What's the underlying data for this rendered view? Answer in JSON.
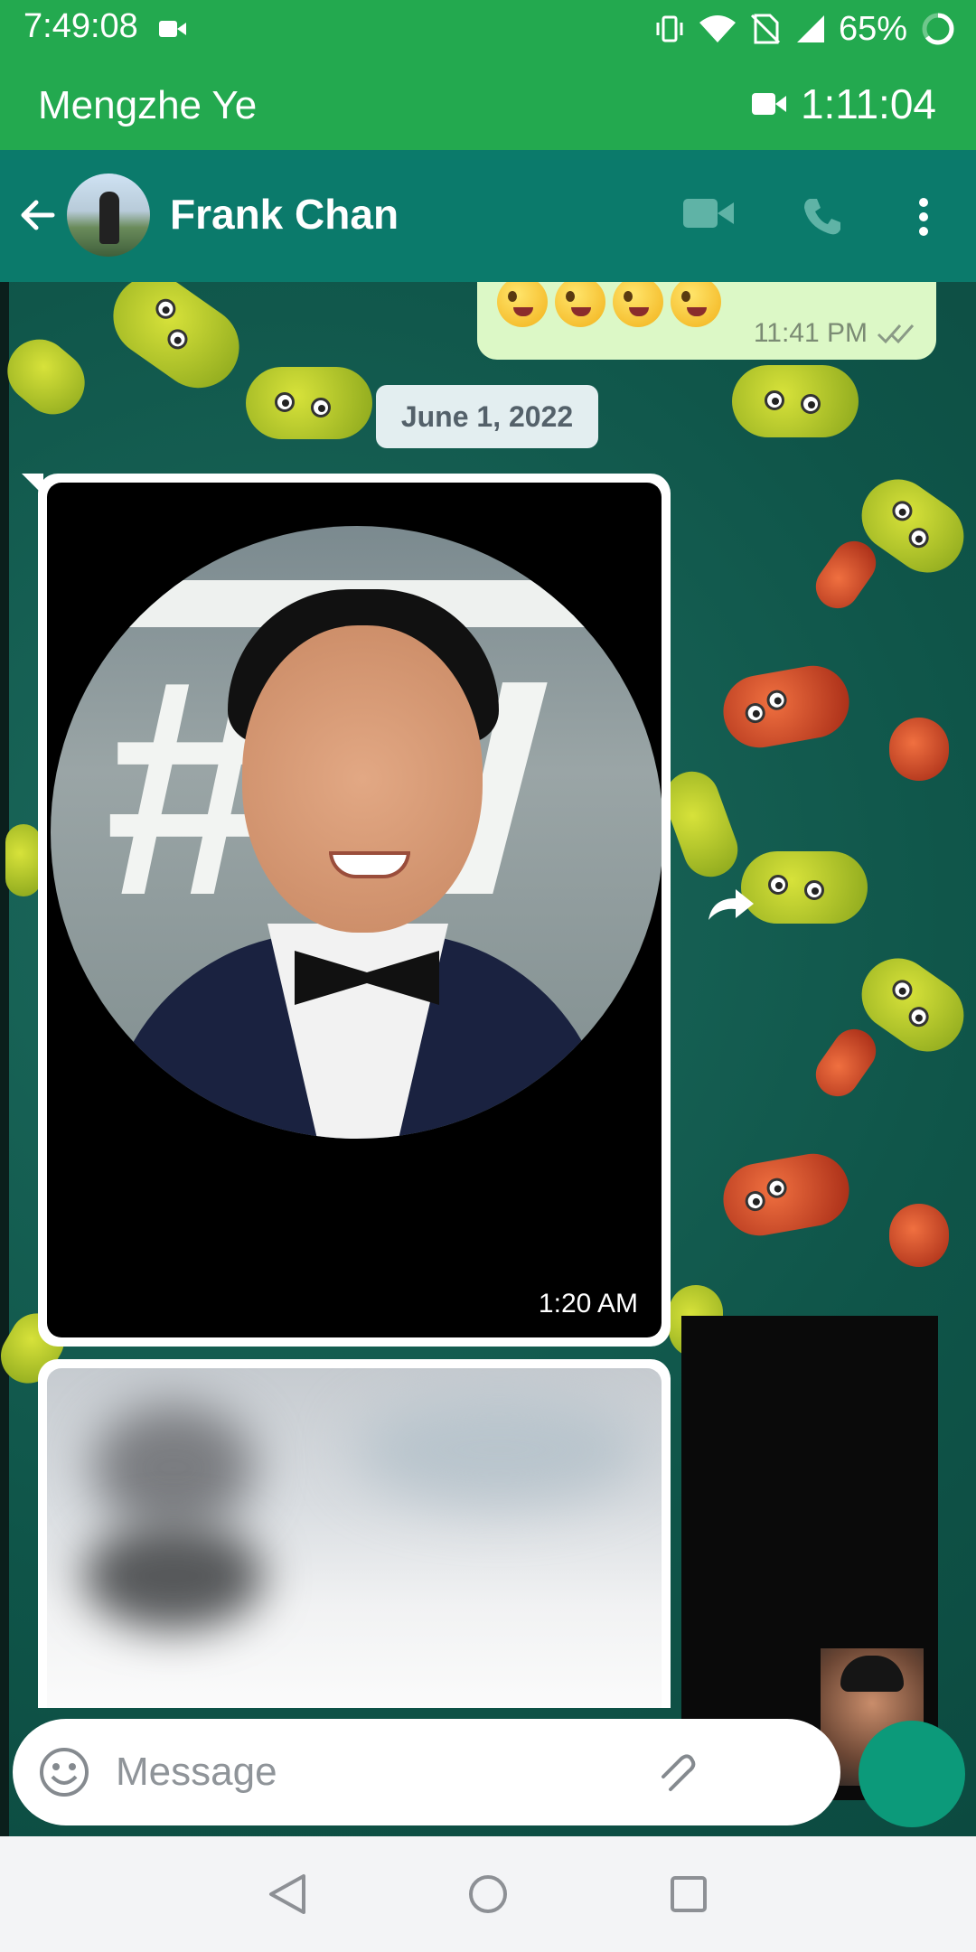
{
  "status_bar": {
    "time": "7:49:08",
    "battery": "65%",
    "icons": [
      "video-record-icon",
      "vibrate-icon",
      "wifi-icon",
      "no-sim-icon",
      "signal-icon",
      "battery-ring-icon"
    ]
  },
  "call_banner": {
    "caller_name": "Mengzhe Ye",
    "duration": "1:11:04",
    "icon": "video-camera-icon"
  },
  "header": {
    "contact_name": "Frank Chan",
    "icons": [
      "back-arrow-icon",
      "video-call-icon",
      "phone-call-icon",
      "more-vert-icon"
    ]
  },
  "messages": {
    "outgoing_emoji": {
      "time": "11:41 PM",
      "emoji_count": 4,
      "status_icon": "double-check-icon"
    },
    "date_chip": "June 1, 2022",
    "image_message": {
      "time": "1:20 AM"
    }
  },
  "input": {
    "placeholder": "Message",
    "icons": [
      "emoji-icon",
      "attach-icon"
    ]
  },
  "colors": {
    "status_green": "#23a94f",
    "header_teal": "#0b7a6b",
    "bubble_out": "#dcf8c6",
    "fab": "#0c9a7a"
  }
}
